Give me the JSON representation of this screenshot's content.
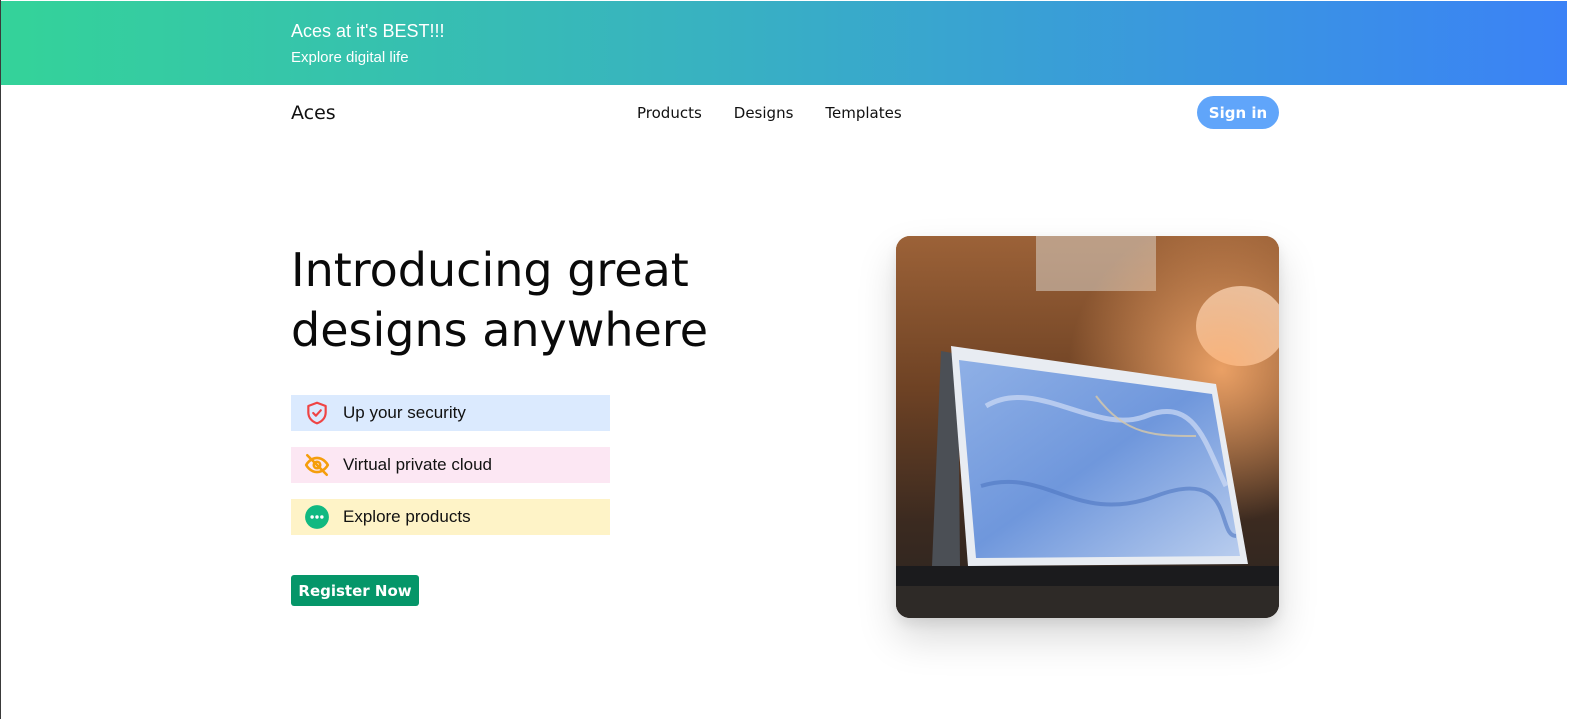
{
  "banner": {
    "title": "Aces at it's BEST!!!",
    "subtitle": "Explore digital life"
  },
  "header": {
    "brand": "Aces",
    "nav": [
      {
        "label": "Products"
      },
      {
        "label": "Designs"
      },
      {
        "label": "Templates"
      }
    ],
    "signin_label": "Sign in"
  },
  "hero": {
    "title": "Introducing great designs anywhere",
    "features": [
      {
        "label": "Up your security",
        "icon": "shield-check-icon",
        "icon_color": "#ef4444",
        "bg": "#dbeafe"
      },
      {
        "label": "Virtual private cloud",
        "icon": "eye-off-icon",
        "icon_color": "#f59e0b",
        "bg": "#fce7f3"
      },
      {
        "label": "Explore products",
        "icon": "dots-circle-icon",
        "icon_color": "#10b981",
        "bg": "#fef3c7"
      }
    ],
    "register_label": "Register Now",
    "image_subject": "laptop-tent-mode"
  },
  "colors": {
    "banner_gradient_start": "#34d399",
    "banner_gradient_end": "#3b82f6",
    "signin_bg": "#60a5fa",
    "register_bg": "#059669"
  }
}
